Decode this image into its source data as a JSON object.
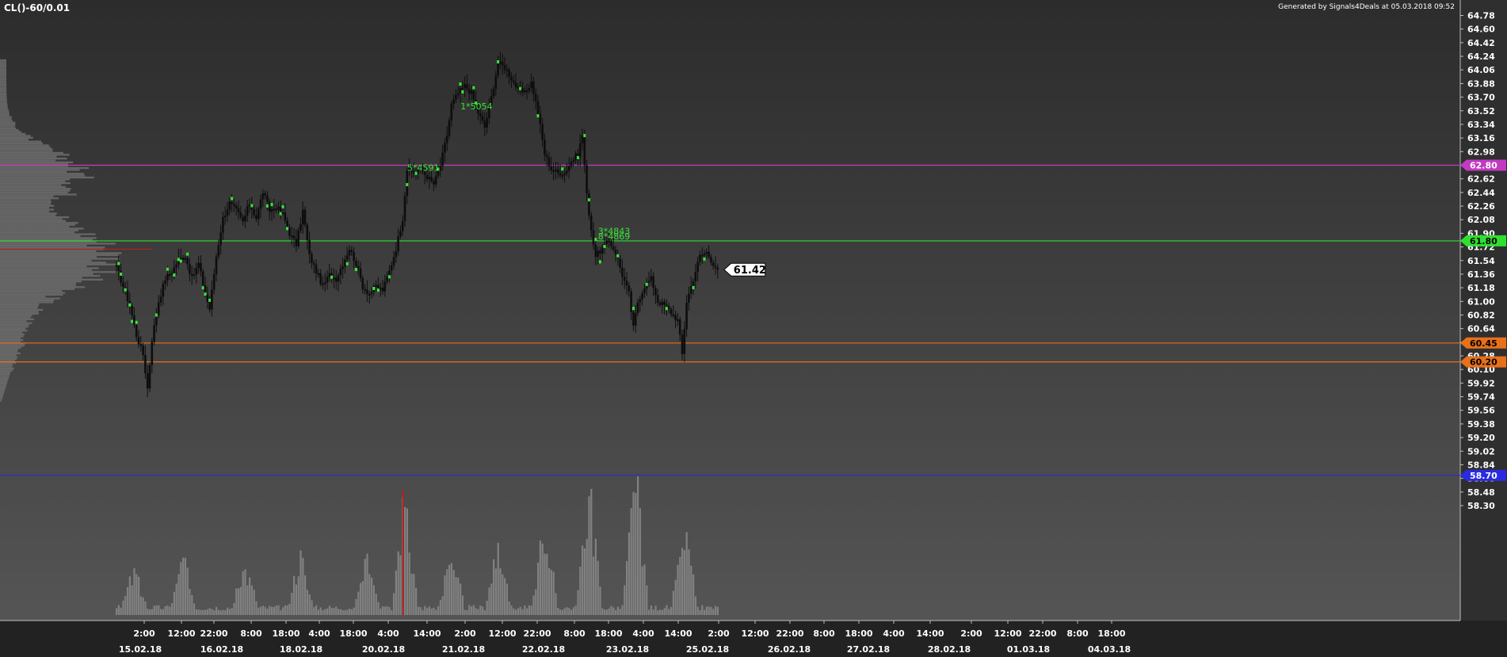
{
  "header": {
    "symbol": "CL()-60/0.01",
    "generated_by": "Generated by Signals4Deals at 05.03.2018 09:52"
  },
  "colors": {
    "background_top": "#2c2c2c",
    "background_bottom": "#555555",
    "candle": "#0d0d0d",
    "highlight": "#35e835",
    "profile": "#6e6e6e",
    "volume": "#8a8a8a",
    "volume_spike": "#b52222",
    "profile_poc": "#b52222",
    "axis_text": "#ffffff",
    "last_price_bg": "#ffffff"
  },
  "chart_data": {
    "type": "candlestick",
    "ylim": [
      58.2,
      64.9
    ],
    "y_ticks": [
      64.78,
      64.6,
      64.42,
      64.24,
      64.06,
      63.88,
      63.7,
      63.52,
      63.34,
      63.16,
      62.98,
      62.8,
      62.62,
      62.44,
      62.26,
      62.08,
      61.9,
      61.72,
      61.54,
      61.36,
      61.18,
      61.0,
      60.82,
      60.64,
      60.46,
      60.28,
      60.1,
      59.92,
      59.74,
      59.56,
      59.38,
      59.2,
      59.02,
      58.84,
      58.66,
      58.48,
      58.3
    ],
    "x_time_ticks": [
      "2:00",
      "12:00",
      "22:00",
      "8:00",
      "18:00",
      "4:00",
      "18:00",
      "4:00",
      "14:00",
      "2:00",
      "12:00",
      "22:00",
      "8:00",
      "18:00",
      "4:00",
      "14:00",
      "2:00",
      "12:00",
      "22:00",
      "8:00",
      "18:00",
      "4:00",
      "14:00",
      "2:00",
      "12:00",
      "22:00",
      "8:00",
      "18:00"
    ],
    "x_date_ticks": [
      "15.02.18",
      "16.02.18",
      "18.02.18",
      "20.02.18",
      "21.02.18",
      "22.02.18",
      "23.02.18",
      "25.02.18",
      "26.02.18",
      "27.02.18",
      "28.02.18",
      "01.03.18",
      "04.03.18"
    ],
    "close_path": [
      [
        0,
        61.45
      ],
      [
        3,
        61.2
      ],
      [
        6,
        60.95
      ],
      [
        9,
        60.55
      ],
      [
        12,
        60.3
      ],
      [
        14,
        59.85
      ],
      [
        16,
        60.5
      ],
      [
        19,
        61.0
      ],
      [
        22,
        61.3
      ],
      [
        25,
        61.4
      ],
      [
        28,
        61.55
      ],
      [
        31,
        61.6
      ],
      [
        34,
        61.3
      ],
      [
        37,
        61.5
      ],
      [
        40,
        61.1
      ],
      [
        42,
        60.9
      ],
      [
        45,
        61.6
      ],
      [
        48,
        62.1
      ],
      [
        51,
        62.3
      ],
      [
        54,
        62.2
      ],
      [
        57,
        62.05
      ],
      [
        60,
        62.3
      ],
      [
        63,
        62.1
      ],
      [
        66,
        62.45
      ],
      [
        69,
        62.2
      ],
      [
        72,
        62.25
      ],
      [
        75,
        62.15
      ],
      [
        78,
        61.9
      ],
      [
        81,
        61.75
      ],
      [
        84,
        62.2
      ],
      [
        87,
        61.6
      ],
      [
        90,
        61.4
      ],
      [
        93,
        61.2
      ],
      [
        96,
        61.35
      ],
      [
        99,
        61.3
      ],
      [
        102,
        61.5
      ],
      [
        105,
        61.7
      ],
      [
        108,
        61.5
      ],
      [
        111,
        61.2
      ],
      [
        114,
        61.1
      ],
      [
        117,
        61.2
      ],
      [
        120,
        61.15
      ],
      [
        123,
        61.4
      ],
      [
        126,
        61.7
      ],
      [
        129,
        62.1
      ],
      [
        131,
        62.75
      ],
      [
        134,
        62.7
      ],
      [
        137,
        62.75
      ],
      [
        140,
        62.65
      ],
      [
        143,
        62.55
      ],
      [
        146,
        62.8
      ],
      [
        149,
        63.2
      ],
      [
        151,
        63.6
      ],
      [
        154,
        63.75
      ],
      [
        157,
        63.85
      ],
      [
        160,
        63.75
      ],
      [
        163,
        63.5
      ],
      [
        166,
        63.3
      ],
      [
        169,
        63.7
      ],
      [
        172,
        64.15
      ],
      [
        175,
        64.1
      ],
      [
        178,
        63.95
      ],
      [
        181,
        63.8
      ],
      [
        184,
        63.75
      ],
      [
        187,
        63.9
      ],
      [
        190,
        63.5
      ],
      [
        193,
        62.95
      ],
      [
        196,
        62.75
      ],
      [
        199,
        62.7
      ],
      [
        202,
        62.7
      ],
      [
        205,
        62.85
      ],
      [
        208,
        62.95
      ],
      [
        210,
        63.2
      ],
      [
        212,
        62.4
      ],
      [
        214,
        61.95
      ],
      [
        216,
        61.6
      ],
      [
        219,
        61.7
      ],
      [
        222,
        61.8
      ],
      [
        225,
        61.65
      ],
      [
        228,
        61.35
      ],
      [
        231,
        61.1
      ],
      [
        233,
        60.65
      ],
      [
        235,
        61.0
      ],
      [
        238,
        61.2
      ],
      [
        241,
        61.3
      ],
      [
        244,
        61.0
      ],
      [
        247,
        60.95
      ],
      [
        250,
        60.85
      ],
      [
        253,
        60.75
      ],
      [
        255,
        60.3
      ],
      [
        257,
        61.0
      ],
      [
        260,
        61.3
      ],
      [
        263,
        61.6
      ],
      [
        266,
        61.65
      ],
      [
        269,
        61.5
      ],
      [
        271,
        61.42
      ]
    ],
    "total_bars": 380,
    "markers": [
      {
        "label": "5*4591",
        "bar": 130,
        "price": 62.77
      },
      {
        "label": "1*5054",
        "bar": 154,
        "price": 63.58
      },
      {
        "label": "3*4843",
        "bar": 216,
        "price": 61.93
      },
      {
        "label": "8*4869",
        "bar": 216,
        "price": 61.86
      }
    ],
    "levels": [
      {
        "price": 62.8,
        "label": "62.80",
        "color": "#c23ac2",
        "label_color": "#c23ac2",
        "label_text_color": "#ffffff"
      },
      {
        "price": 61.8,
        "label": "61.80",
        "color": "#2fe02f",
        "label_color": "#2fe02f",
        "label_text_color": "#000000"
      },
      {
        "price": 60.45,
        "label": "60.45",
        "color": "#e8701a",
        "label_color": "#e8701a",
        "label_text_color": "#000000"
      },
      {
        "price": 60.2,
        "label": "60.20",
        "color": "#e8701a",
        "label_color": "#e8701a",
        "label_text_color": "#000000"
      },
      {
        "price": 58.7,
        "label": "58.70",
        "color": "#2a2ae0",
        "label_color": "#2a2ae0",
        "label_text_color": "#ffffff"
      }
    ],
    "last_price": {
      "value": 61.42,
      "label": "61.42"
    },
    "volume_peaks": [
      {
        "bar": 8,
        "v": 0.35
      },
      {
        "bar": 30,
        "v": 0.45
      },
      {
        "bar": 58,
        "v": 0.42
      },
      {
        "bar": 83,
        "v": 0.5
      },
      {
        "bar": 113,
        "v": 0.48
      },
      {
        "bar": 130,
        "v": 1.0
      },
      {
        "bar": 151,
        "v": 0.5
      },
      {
        "bar": 172,
        "v": 0.6
      },
      {
        "bar": 193,
        "v": 0.8
      },
      {
        "bar": 213,
        "v": 1.15
      },
      {
        "bar": 234,
        "v": 1.2
      },
      {
        "bar": 256,
        "v": 0.7
      }
    ]
  }
}
